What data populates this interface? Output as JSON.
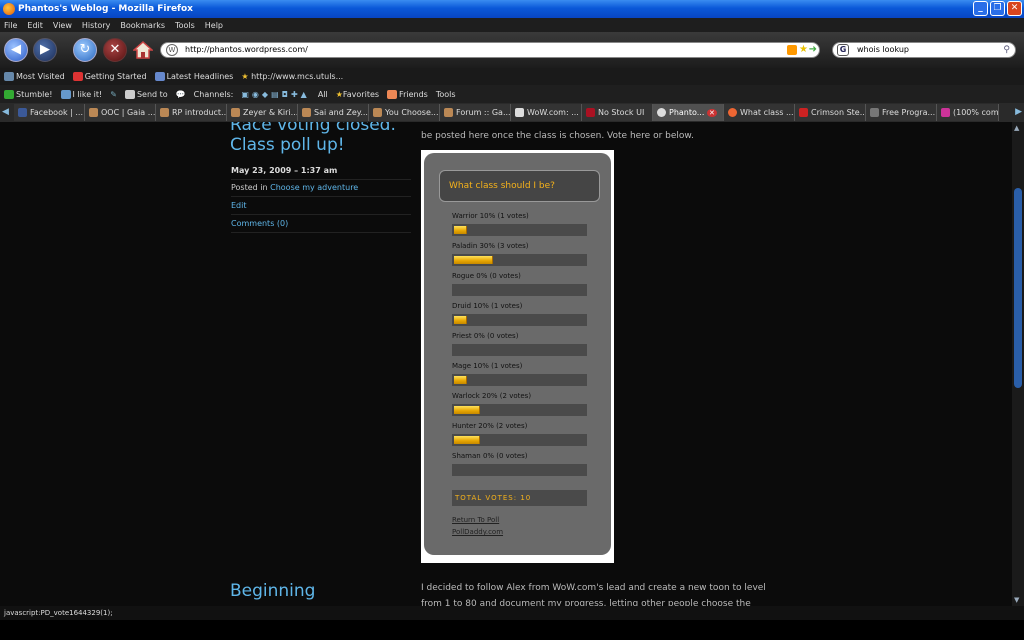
{
  "window": {
    "title": "Phantos's Weblog - Mozilla Firefox"
  },
  "menu": [
    "File",
    "Edit",
    "View",
    "History",
    "Bookmarks",
    "Tools",
    "Help"
  ],
  "nav": {
    "url": "http://phantos.wordpress.com/",
    "search_value": "whois lookup"
  },
  "bookmarks": [
    "Most Visited",
    "Getting Started",
    "Latest Headlines",
    "http://www.mcs.utuls..."
  ],
  "toolbar2": [
    "Stumble!",
    "I like it!",
    "Send to",
    "Channels:",
    "All",
    "Favorites",
    "Friends",
    "Tools"
  ],
  "tabs": [
    {
      "label": "Facebook | ..."
    },
    {
      "label": "OOC | Gaia ..."
    },
    {
      "label": "RP introduct..."
    },
    {
      "label": "Zeyer & Kiri..."
    },
    {
      "label": "Sai and Zey..."
    },
    {
      "label": "You Choose..."
    },
    {
      "label": "Forum :: Ga..."
    },
    {
      "label": "WoW.com: ..."
    },
    {
      "label": "No Stock UI"
    },
    {
      "label": "Phanto..."
    },
    {
      "label": "What class ..."
    },
    {
      "label": "Crimson Ste..."
    },
    {
      "label": "Free Progra..."
    },
    {
      "label": "(100% com..."
    }
  ],
  "post1": {
    "title_line1": "Race voting closed.",
    "title_line2": "Class poll up!",
    "date": "May 23, 2009 – 1:37 am",
    "posted_in_prefix": "Posted in",
    "category": "Choose my adventure",
    "edit": "Edit",
    "comments": "Comments (0)",
    "body_top": "be posted here once the class is chosen. Vote here or below."
  },
  "poll": {
    "question": "What class should I be?",
    "options": [
      {
        "label": "Warrior 10% (1 votes)",
        "pct": 10
      },
      {
        "label": "Paladin 30% (3 votes)",
        "pct": 30
      },
      {
        "label": "Rogue 0% (0 votes)",
        "pct": 0
      },
      {
        "label": "Druid 10% (1 votes)",
        "pct": 10
      },
      {
        "label": "Priest 0% (0 votes)",
        "pct": 0
      },
      {
        "label": "Mage 10% (1 votes)",
        "pct": 10
      },
      {
        "label": "Warlock 20% (2 votes)",
        "pct": 20
      },
      {
        "label": "Hunter 20% (2 votes)",
        "pct": 20
      },
      {
        "label": "Shaman 0% (0 votes)",
        "pct": 0
      }
    ],
    "total": "TOTAL VOTES: 10",
    "return_link": "Return To Poll",
    "polldaddy_link": "PollDaddy.com"
  },
  "post2": {
    "title": "Beginning",
    "body_line1": "I decided to follow Alex from WoW.com's lead and create a new toon to level",
    "body_line2": "from 1 to 80 and document my progress, letting other people choose the"
  },
  "status": {
    "text": "javascript:PD_vote1644329(1);"
  }
}
